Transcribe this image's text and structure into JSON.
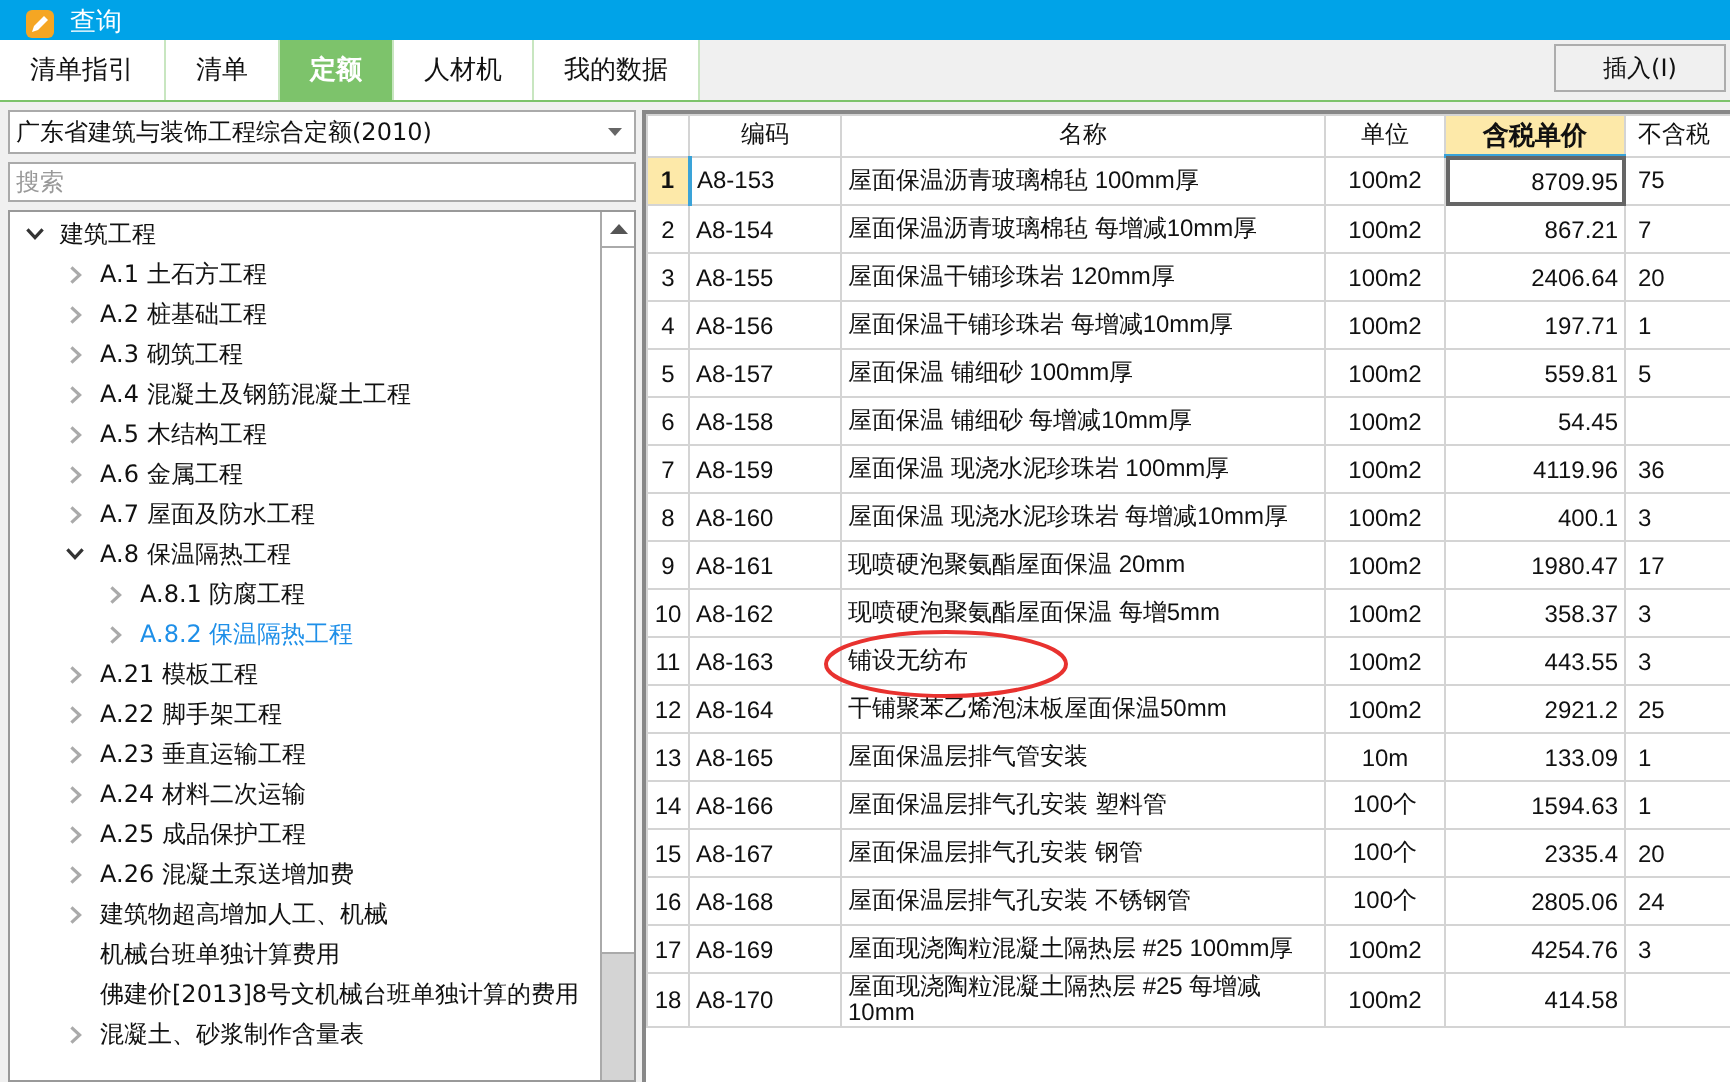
{
  "window": {
    "title": "查询"
  },
  "tabs": [
    {
      "label": "清单指引",
      "selected": false
    },
    {
      "label": "清单",
      "selected": false
    },
    {
      "label": "定额",
      "selected": true
    },
    {
      "label": "人材机",
      "selected": false
    },
    {
      "label": "我的数据",
      "selected": false
    }
  ],
  "insert_button": "插入(I)",
  "library_select": {
    "value": "广东省建筑与装饰工程综合定额(2010)"
  },
  "search": {
    "placeholder": "搜索"
  },
  "tree": [
    {
      "label": "建筑工程",
      "kind": "folder",
      "expanded": true,
      "selected": false,
      "children": [
        {
          "label": "A.1 土石方工程",
          "kind": "folder",
          "selected": false
        },
        {
          "label": "A.2 桩基础工程",
          "kind": "folder",
          "selected": false
        },
        {
          "label": "A.3 砌筑工程",
          "kind": "folder",
          "selected": false
        },
        {
          "label": "A.4 混凝土及钢筋混凝土工程",
          "kind": "folder",
          "selected": false
        },
        {
          "label": "A.5 木结构工程",
          "kind": "folder",
          "selected": false
        },
        {
          "label": "A.6 金属工程",
          "kind": "folder",
          "selected": false
        },
        {
          "label": "A.7 屋面及防水工程",
          "kind": "folder",
          "selected": false
        },
        {
          "label": "A.8 保温隔热工程",
          "kind": "folder",
          "expanded": true,
          "selected": false,
          "children": [
            {
              "label": "A.8.1 防腐工程",
              "kind": "folder",
              "selected": false
            },
            {
              "label": "A.8.2 保温隔热工程",
              "kind": "folder",
              "selected": true
            }
          ]
        },
        {
          "label": "A.21 模板工程",
          "kind": "folder",
          "selected": false
        },
        {
          "label": "A.22 脚手架工程",
          "kind": "folder",
          "selected": false
        },
        {
          "label": "A.23 垂直运输工程",
          "kind": "folder",
          "selected": false
        },
        {
          "label": "A.24 材料二次运输",
          "kind": "folder",
          "selected": false
        },
        {
          "label": "A.25 成品保护工程",
          "kind": "folder",
          "selected": false
        },
        {
          "label": "A.26 混凝土泵送增加费",
          "kind": "folder",
          "selected": false
        },
        {
          "label": "建筑物超高增加人工、机械",
          "kind": "folder",
          "selected": false
        },
        {
          "label": "机械台班单独计算费用",
          "kind": "leaf",
          "selected": false
        },
        {
          "label": "佛建价[2013]8号文机械台班单独计算的费用",
          "kind": "leaf",
          "selected": false
        },
        {
          "label": "混凝土、砂浆制作含量表",
          "kind": "folder",
          "selected": false
        }
      ]
    }
  ],
  "table": {
    "columns": [
      {
        "label": "编码",
        "selected": false
      },
      {
        "label": "名称",
        "selected": false
      },
      {
        "label": "单位",
        "selected": false
      },
      {
        "label": "含税单价",
        "selected": true
      },
      {
        "label": "不含税",
        "selected": false
      }
    ],
    "rows": [
      {
        "number": "1",
        "code": "A8-153",
        "name": "屋面保温沥青玻璃棉毡 100mm厚",
        "unit": "100m2",
        "price": "8709.95",
        "column_6": "75",
        "selected": true,
        "circled": false
      },
      {
        "number": "2",
        "code": "A8-154",
        "name": "屋面保温沥青玻璃棉毡 每增减10mm厚",
        "unit": "100m2",
        "price": "867.21",
        "column_6": "7",
        "selected": false,
        "circled": false
      },
      {
        "number": "3",
        "code": "A8-155",
        "name": "屋面保温干铺珍珠岩 120mm厚",
        "unit": "100m2",
        "price": "2406.64",
        "column_6": "20",
        "selected": false,
        "circled": false
      },
      {
        "number": "4",
        "code": "A8-156",
        "name": "屋面保温干铺珍珠岩 每增减10mm厚",
        "unit": "100m2",
        "price": "197.71",
        "column_6": "1",
        "selected": false,
        "circled": false
      },
      {
        "number": "5",
        "code": "A8-157",
        "name": "屋面保温 铺细砂 100mm厚",
        "unit": "100m2",
        "price": "559.81",
        "column_6": "5",
        "selected": false,
        "circled": false
      },
      {
        "number": "6",
        "code": "A8-158",
        "name": "屋面保温 铺细砂 每增减10mm厚",
        "unit": "100m2",
        "price": "54.45",
        "selected": false,
        "circled": false
      },
      {
        "number": "7",
        "code": "A8-159",
        "name": "屋面保温 现浇水泥珍珠岩 100mm厚",
        "unit": "100m2",
        "price": "4119.96",
        "column_6": "36",
        "selected": false,
        "circled": false
      },
      {
        "number": "8",
        "code": "A8-160",
        "name": "屋面保温 现浇水泥珍珠岩 每增减10mm厚",
        "unit": "100m2",
        "price": "400.1",
        "column_6": "3",
        "selected": false,
        "circled": false
      },
      {
        "number": "9",
        "code": "A8-161",
        "name": "现喷硬泡聚氨酯屋面保温 20mm",
        "unit": "100m2",
        "price": "1980.47",
        "column_6": "17",
        "selected": false,
        "circled": false
      },
      {
        "number": "10",
        "code": "A8-162",
        "name": "现喷硬泡聚氨酯屋面保温 每增5mm",
        "unit": "100m2",
        "price": "358.37",
        "column_6": "3",
        "selected": false,
        "circled": false
      },
      {
        "number": "11",
        "code": "A8-163",
        "name": "铺设无纺布",
        "unit": "100m2",
        "price": "443.55",
        "column_6": "3",
        "selected": false,
        "circled": true
      },
      {
        "number": "12",
        "code": "A8-164",
        "name": "干铺聚苯乙烯泡沫板屋面保温50mm",
        "unit": "100m2",
        "price": "2921.2",
        "column_6": "25",
        "selected": false,
        "circled": false
      },
      {
        "number": "13",
        "code": "A8-165",
        "name": "屋面保温层排气管安装",
        "unit": "10m",
        "price": "133.09",
        "column_6": "1",
        "selected": false,
        "circled": false
      },
      {
        "number": "14",
        "code": "A8-166",
        "name": "屋面保温层排气孔安装 塑料管",
        "unit": "100个",
        "price": "1594.63",
        "column_6": "1",
        "selected": false,
        "circled": false
      },
      {
        "number": "15",
        "code": "A8-167",
        "name": "屋面保温层排气孔安装 钢管",
        "unit": "100个",
        "price": "2335.4",
        "column_6": "20",
        "selected": false,
        "circled": false
      },
      {
        "number": "16",
        "code": "A8-168",
        "name": "屋面保温层排气孔安装 不锈钢管",
        "unit": "100个",
        "price": "2805.06",
        "column_6": "24",
        "selected": false,
        "circled": false
      },
      {
        "number": "17",
        "code": "A8-169",
        "name": "屋面现浇陶粒混凝土隔热层 #25 100mm厚",
        "unit": "100m2",
        "price": "4254.76",
        "column_6": "3",
        "selected": false,
        "circled": false
      },
      {
        "number": "18",
        "code": "A8-170",
        "name": "屋面现浇陶粒混凝土隔热层 #25 每增减10mm",
        "unit": "100m2",
        "price": "414.58",
        "selected": false,
        "circled": false
      }
    ]
  }
}
